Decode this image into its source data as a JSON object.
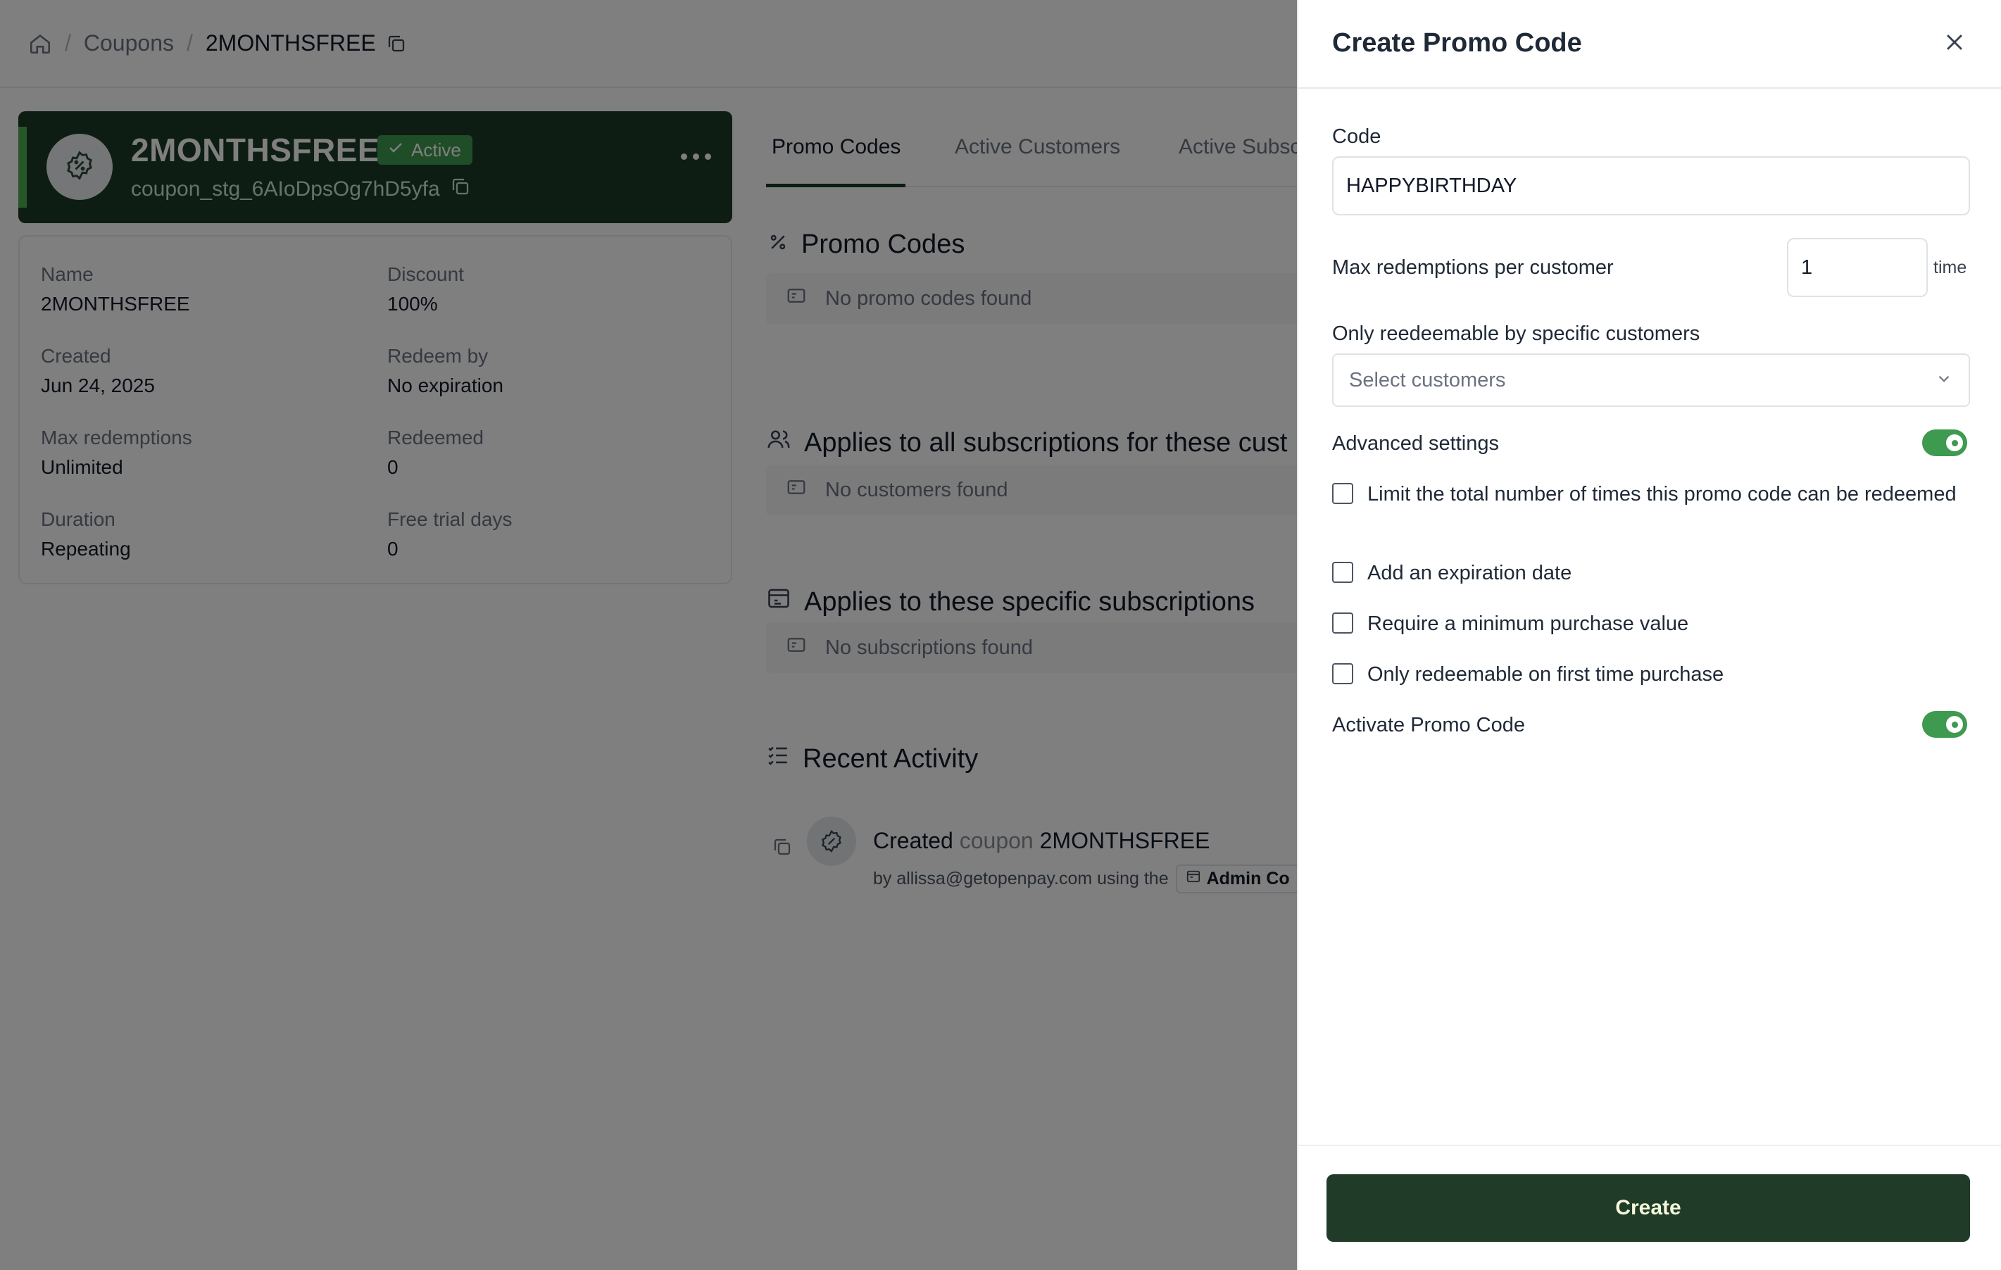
{
  "breadcrumb": {
    "items": [
      "Coupons",
      "2MONTHSFREE"
    ]
  },
  "coupon": {
    "name": "2MONTHSFREE",
    "status": "Active",
    "id": "coupon_stg_6AIoDpsOg7hD5yfa"
  },
  "details": [
    {
      "label": "Name",
      "value": "2MONTHSFREE"
    },
    {
      "label": "Discount",
      "value": "100%"
    },
    {
      "label": "Created",
      "value": "Jun 24, 2025"
    },
    {
      "label": "Redeem by",
      "value": "No expiration"
    },
    {
      "label": "Max redemptions",
      "value": "Unlimited"
    },
    {
      "label": "Redeemed",
      "value": "0"
    },
    {
      "label": "Duration",
      "value": "Repeating"
    },
    {
      "label": "Free trial days",
      "value": "0"
    }
  ],
  "tabs": [
    "Promo Codes",
    "Active Customers",
    "Active Subsc"
  ],
  "sections": {
    "promo_codes": {
      "title": "Promo Codes",
      "empty": "No promo codes found"
    },
    "customers": {
      "title": "Applies to all subscriptions for these cust",
      "empty": "No customers found"
    },
    "subscriptions": {
      "title": "Applies to these specific subscriptions",
      "empty": "No subscriptions found"
    },
    "activity": {
      "title": "Recent Activity",
      "verb": "Created",
      "object_type": "coupon",
      "object_name": "2MONTHSFREE",
      "by_text": "by allissa@getopenpay.com using the",
      "via": "Admin Co"
    }
  },
  "drawer": {
    "title": "Create Promo Code",
    "code_label": "Code",
    "code_value": "HAPPYBIRTHDAY",
    "max_label": "Max redemptions per customer",
    "max_value": "1",
    "max_suffix": "time",
    "customers_label": "Only reedeemable by specific customers",
    "customers_placeholder": "Select customers",
    "advanced_label": "Advanced settings",
    "options": [
      "Limit the total number of times this promo code can be redeemed",
      "Add an expiration date",
      "Require a minimum purchase value",
      "Only redeemable on first time purchase"
    ],
    "activate_label": "Activate Promo Code",
    "create_label": "Create"
  },
  "colors": {
    "brand_dark": "#1b3b26",
    "accent_green": "#3e9a4e"
  }
}
